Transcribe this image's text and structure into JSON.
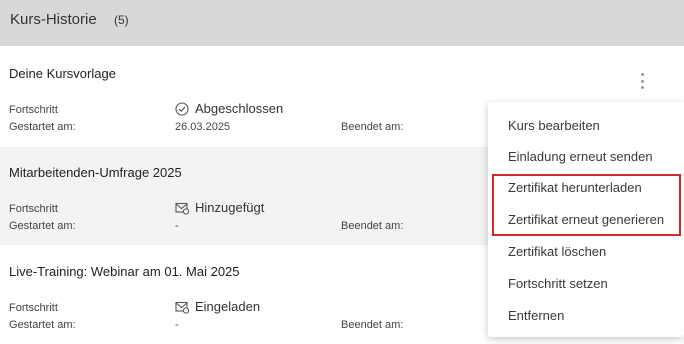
{
  "header": {
    "title": "Kurs-Historie",
    "count": "(5)"
  },
  "labels": {
    "progress": "Fortschritt",
    "started": "Gestartet am:",
    "ended": "Beendet am:"
  },
  "courses": [
    {
      "name": "Deine Kursvorlage",
      "status": "Abgeschlossen",
      "status_icon": "check-circle-icon",
      "started": "26.03.2025"
    },
    {
      "name": "Mitarbeitenden-Umfrage 2025",
      "status": "Hinzugefügt",
      "status_icon": "mail-icon",
      "started": "-"
    },
    {
      "name": "Live-Training: Webinar am 01. Mai 2025",
      "status": "Eingeladen",
      "status_icon": "mail-icon",
      "started": "-"
    }
  ],
  "menu": {
    "items": [
      "Kurs bearbeiten",
      "Einladung erneut senden",
      "Zertifikat herunterladen",
      "Zertifikat erneut generieren",
      "Zertifikat löschen",
      "Fortschritt setzen",
      "Entfernen"
    ]
  },
  "colors": {
    "header_bg": "#d8d8d8",
    "highlight": "#d12a2a",
    "alt_row": "#f3f3f3"
  }
}
